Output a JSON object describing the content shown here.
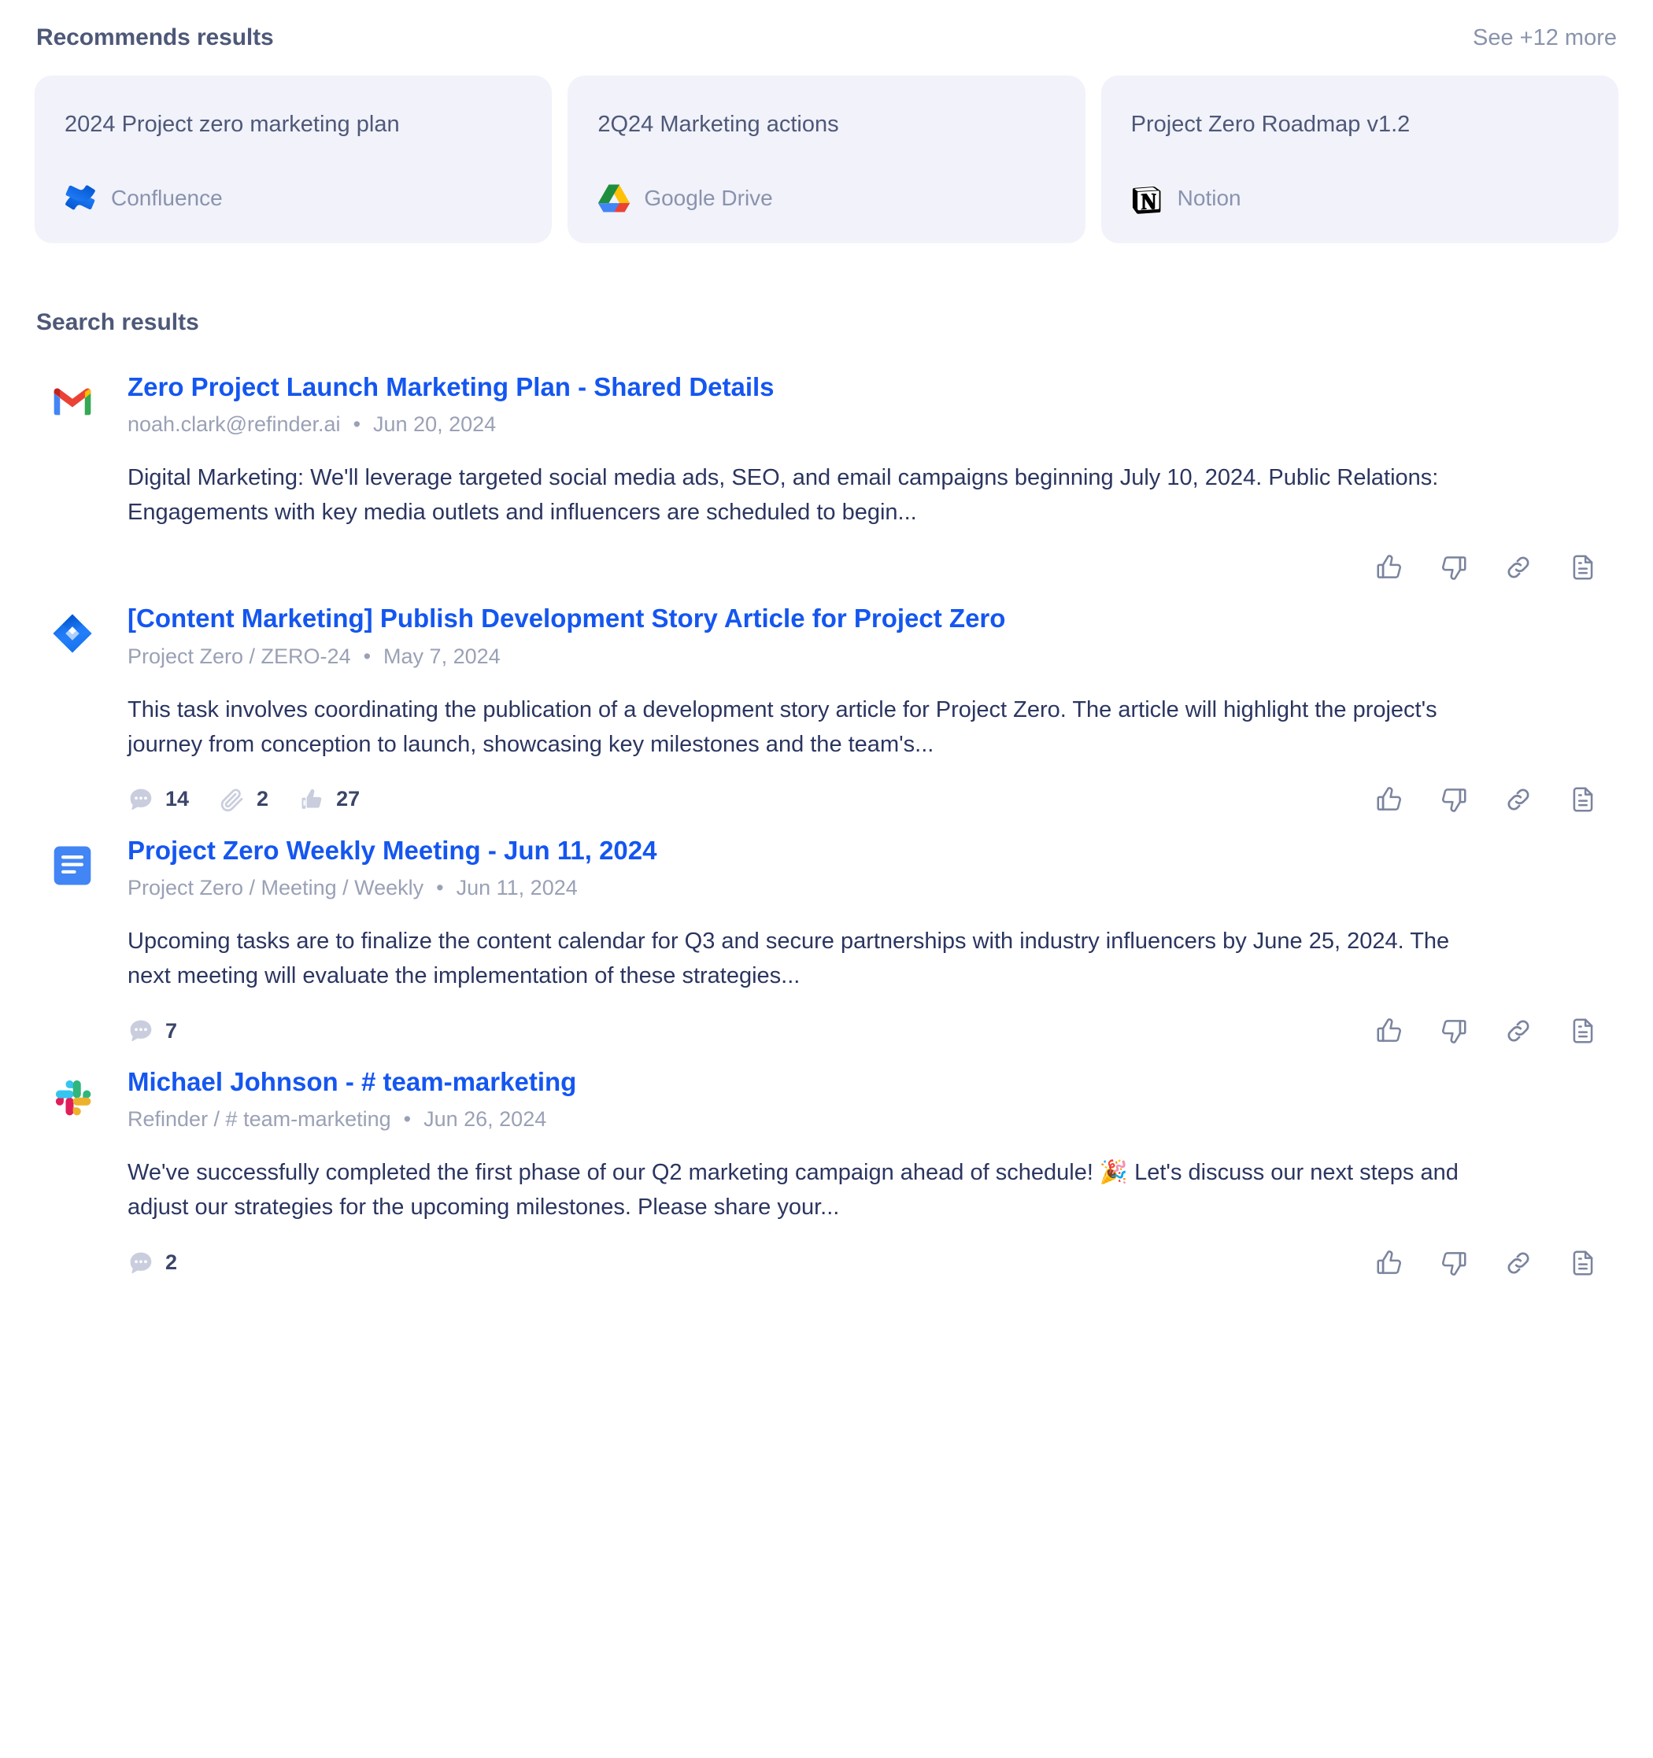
{
  "recommends": {
    "title": "Recommends results",
    "see_more_label": "See +12 more",
    "cards": [
      {
        "title": "2024 Project zero marketing plan",
        "source": "Confluence",
        "icon": "confluence-icon"
      },
      {
        "title": "2Q24 Marketing actions",
        "source": "Google Drive",
        "icon": "google-drive-icon"
      },
      {
        "title": "Project Zero Roadmap v1.2",
        "source": "Notion",
        "icon": "notion-icon"
      }
    ]
  },
  "search": {
    "title": "Search results",
    "results": [
      {
        "icon": "gmail-icon",
        "title": "Zero Project Launch Marketing Plan - Shared Details",
        "meta_source": "noah.clark@refinder.ai",
        "meta_sep": "•",
        "meta_date": "Jun 20, 2024",
        "snippet": "Digital Marketing: We'll leverage targeted social media ads, SEO, and email campaigns beginning July 10, 2024. Public Relations: Engagements with key media outlets and influencers are scheduled to begin...",
        "stats": []
      },
      {
        "icon": "jira-icon",
        "title": "[Content Marketing] Publish Development Story Article for Project Zero",
        "meta_source": "Project Zero / ZERO-24",
        "meta_sep": "•",
        "meta_date": "May 7, 2024",
        "snippet": "This task involves coordinating the publication of a development story article for Project Zero. The article will highlight the project's journey from conception to launch, showcasing key milestones and the team's...",
        "stats": [
          {
            "icon": "comment-icon",
            "value": "14"
          },
          {
            "icon": "attachment-icon",
            "value": "2"
          },
          {
            "icon": "thumbs-up-filled-icon",
            "value": "27"
          }
        ]
      },
      {
        "icon": "google-docs-icon",
        "title": "Project Zero Weekly Meeting - Jun 11, 2024",
        "meta_source": "Project Zero / Meeting / Weekly",
        "meta_sep": "•",
        "meta_date": "Jun 11, 2024",
        "snippet": "Upcoming tasks are to finalize the content calendar for Q3 and secure partnerships with industry influencers by June 25, 2024. The next meeting will evaluate the implementation of these strategies...",
        "stats": [
          {
            "icon": "comment-icon",
            "value": "7"
          }
        ]
      },
      {
        "icon": "slack-icon",
        "title": "Michael Johnson - # team-marketing",
        "meta_source": "Refinder / # team-marketing",
        "meta_sep": "•",
        "meta_date": "Jun 26, 2024",
        "snippet": "We've successfully completed the first phase of our Q2 marketing campaign ahead of schedule! 🎉 Let's discuss our next steps and adjust our strategies for the upcoming milestones. Please share your...",
        "stats": [
          {
            "icon": "comment-icon",
            "value": "2"
          }
        ]
      }
    ],
    "actions": [
      {
        "name": "thumbs-up-button",
        "icon": "thumbs-up-icon"
      },
      {
        "name": "thumbs-down-button",
        "icon": "thumbs-down-icon"
      },
      {
        "name": "copy-link-button",
        "icon": "link-icon"
      },
      {
        "name": "open-document-button",
        "icon": "document-icon"
      }
    ]
  },
  "colors": {
    "link": "#1456f0",
    "heading": "#4e5878",
    "muted": "#9aa1b6",
    "card_bg": "#f1f2fa",
    "snippet": "#2b3560",
    "icon_stroke": "#7b849e"
  }
}
